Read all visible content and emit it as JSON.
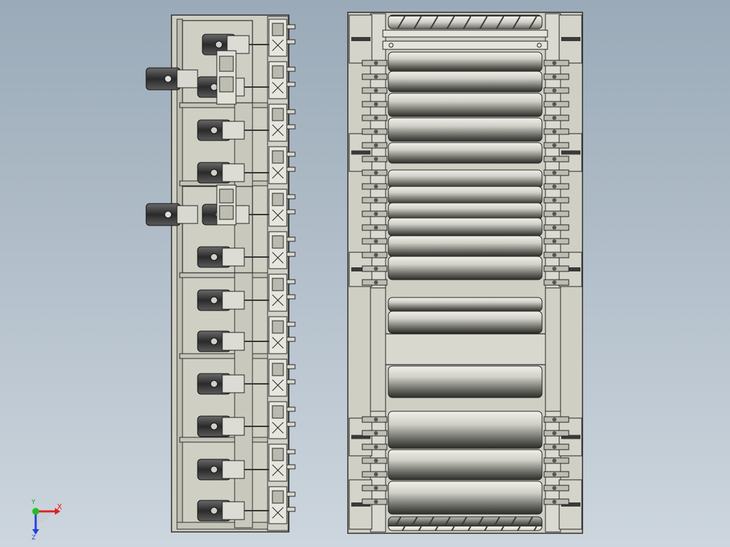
{
  "viewport": {
    "background_top": "#9aaab8",
    "background_bottom": "#cdd6de"
  },
  "drawing": {
    "frame_color": "#cfcfc4",
    "line_color": "#2b2b2b",
    "motor_color": "#3a3a3a",
    "roller_light": "#e2e2dc",
    "roller_dark": "#4a4a46"
  },
  "triad": {
    "x_label": "X",
    "y_label": "Y",
    "z_label": "Z",
    "x_color": "#e02020",
    "y_color": "#20c020",
    "z_color": "#2040e0"
  }
}
